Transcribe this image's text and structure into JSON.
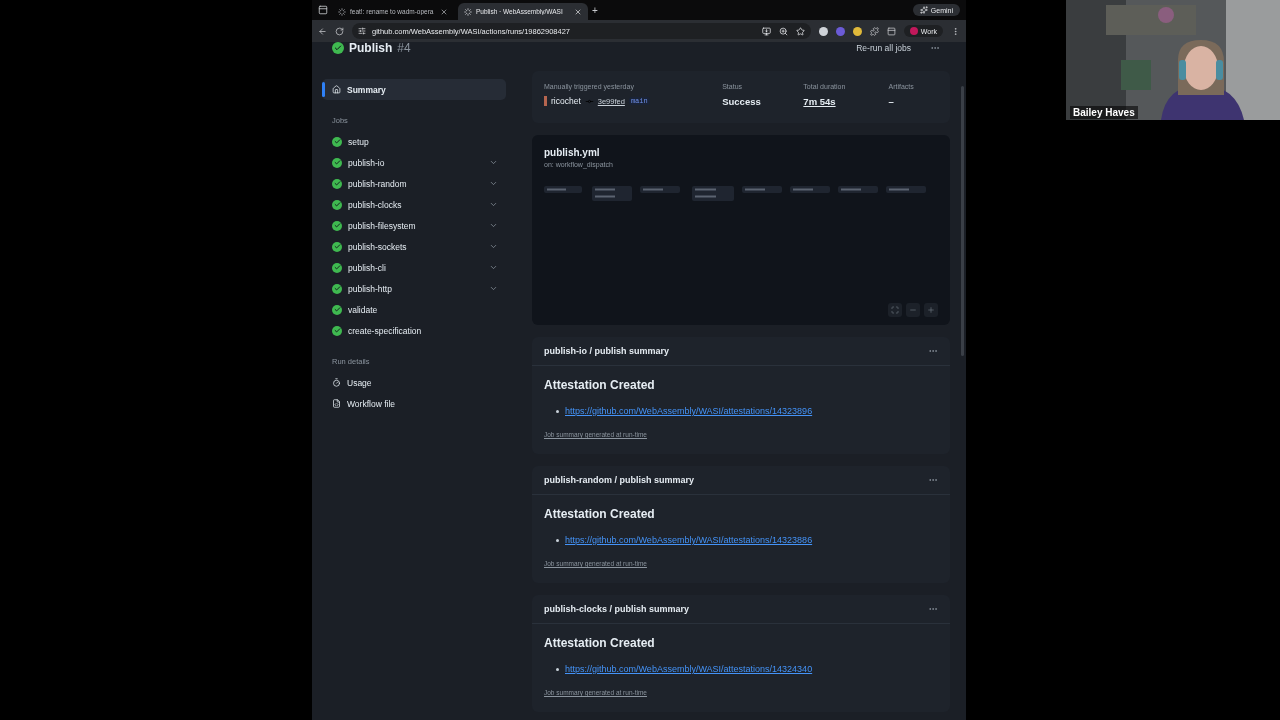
{
  "browser": {
    "tabs": [
      {
        "title": "feat!: rename to wadm-opera",
        "selected": false
      },
      {
        "title": "Publish · WebAssembly/WASI",
        "selected": true
      }
    ],
    "new_tab": "+",
    "gemini": "Gemini",
    "url": "github.com/WebAssembly/WASI/actions/runs/19862908427",
    "profile": "Work"
  },
  "run": {
    "title": "Publish",
    "number": "#4",
    "rerun": "Re-run all jobs"
  },
  "sidebar": {
    "summary": {
      "label": "Summary",
      "selected": true
    },
    "jobs_heading": "Jobs",
    "jobs": [
      {
        "name": "setup",
        "expandable": false,
        "selected": false
      },
      {
        "name": "publish-io",
        "expandable": true,
        "selected": false
      },
      {
        "name": "publish-random",
        "expandable": true,
        "selected": false
      },
      {
        "name": "publish-clocks",
        "expandable": true,
        "selected": false
      },
      {
        "name": "publish-filesystem",
        "expandable": true,
        "selected": false
      },
      {
        "name": "publish-sockets",
        "expandable": true,
        "selected": false
      },
      {
        "name": "publish-cli",
        "expandable": true,
        "selected": false
      },
      {
        "name": "publish-http",
        "expandable": true,
        "selected": false
      },
      {
        "name": "validate",
        "expandable": false,
        "selected": false
      },
      {
        "name": "create-specification",
        "expandable": false,
        "selected": false
      }
    ],
    "run_details_heading": "Run details",
    "details": [
      {
        "label": "Usage",
        "kind": "usage"
      },
      {
        "label": "Workflow file",
        "kind": "file"
      }
    ]
  },
  "summary": {
    "trigger_label": "Manually triggered yesterday",
    "actor": "ricochet",
    "commit": "3e99fed",
    "branch": "main",
    "status_label": "Status",
    "status": "Success",
    "duration_label": "Total duration",
    "duration": "7m 54s",
    "artifacts_label": "Artifacts",
    "artifacts": "–"
  },
  "graph": {
    "file": "publish.yml",
    "trigger": "on: workflow_dispatch"
  },
  "job_summaries": [
    {
      "title": "publish-io / publish summary",
      "heading": "Attestation Created",
      "link": "https://github.com/WebAssembly/WASI/attestations/14323896",
      "footer": "Job summary generated at run-time"
    },
    {
      "title": "publish-random / publish summary",
      "heading": "Attestation Created",
      "link": "https://github.com/WebAssembly/WASI/attestations/14323886",
      "footer": "Job summary generated at run-time"
    },
    {
      "title": "publish-clocks / publish summary",
      "heading": "Attestation Created",
      "link": "https://github.com/WebAssembly/WASI/attestations/14324340",
      "footer": "Job summary generated at run-time"
    }
  ],
  "participant": {
    "name": "Bailey Haves"
  }
}
